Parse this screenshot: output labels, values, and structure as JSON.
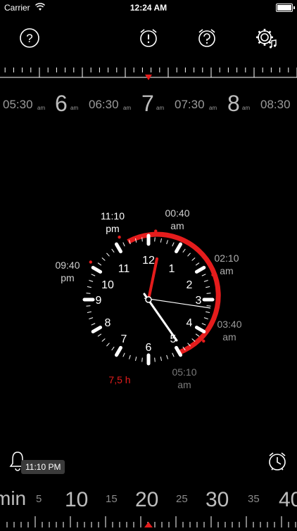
{
  "status": {
    "carrier": "Carrier",
    "time": "12:24 AM"
  },
  "toolbar": {
    "help_icon": "help-icon",
    "alarm_warning_icon": "alarm-warning-icon",
    "alarm_question_icon": "alarm-question-icon",
    "settings_music_icon": "settings-music-icon"
  },
  "wake_ruler": {
    "labels": [
      {
        "big": "",
        "small": "05:30",
        "suffix": "am"
      },
      {
        "big": "6",
        "small": "",
        "suffix": "am"
      },
      {
        "big": "",
        "small": "06:30",
        "suffix": "am"
      },
      {
        "big": "7",
        "small": "",
        "suffix": "am"
      },
      {
        "big": "",
        "small": "07:30",
        "suffix": "am"
      },
      {
        "big": "8",
        "small": "",
        "suffix": "am"
      },
      {
        "big": "",
        "small": "08:30",
        "suffix": "am"
      }
    ]
  },
  "clock": {
    "numbers": [
      "12",
      "1",
      "2",
      "3",
      "4",
      "5",
      "6",
      "7",
      "8",
      "9",
      "10",
      "11"
    ],
    "markers": {
      "m1110": {
        "line1": "11:10",
        "line2": "pm"
      },
      "m0040": {
        "line1": "00:40",
        "line2": "am"
      },
      "m0940": {
        "line1": "09:40",
        "line2": "pm"
      },
      "m0210": {
        "line1": "02:10",
        "line2": "am"
      },
      "m0340": {
        "line1": "03:40",
        "line2": "am"
      },
      "m0510": {
        "line1": "05:10",
        "line2": "am"
      }
    },
    "duration": "7,5 h"
  },
  "bottom": {
    "tooltip": "11:10 PM",
    "ruler": {
      "unit": "min",
      "labels": [
        "5",
        "10",
        "15",
        "20",
        "25",
        "30",
        "35",
        "40"
      ]
    }
  },
  "colors": {
    "accent": "#e51c1c",
    "background": "#000000",
    "text": "#ffffff",
    "muted": "#9a9a9a"
  }
}
